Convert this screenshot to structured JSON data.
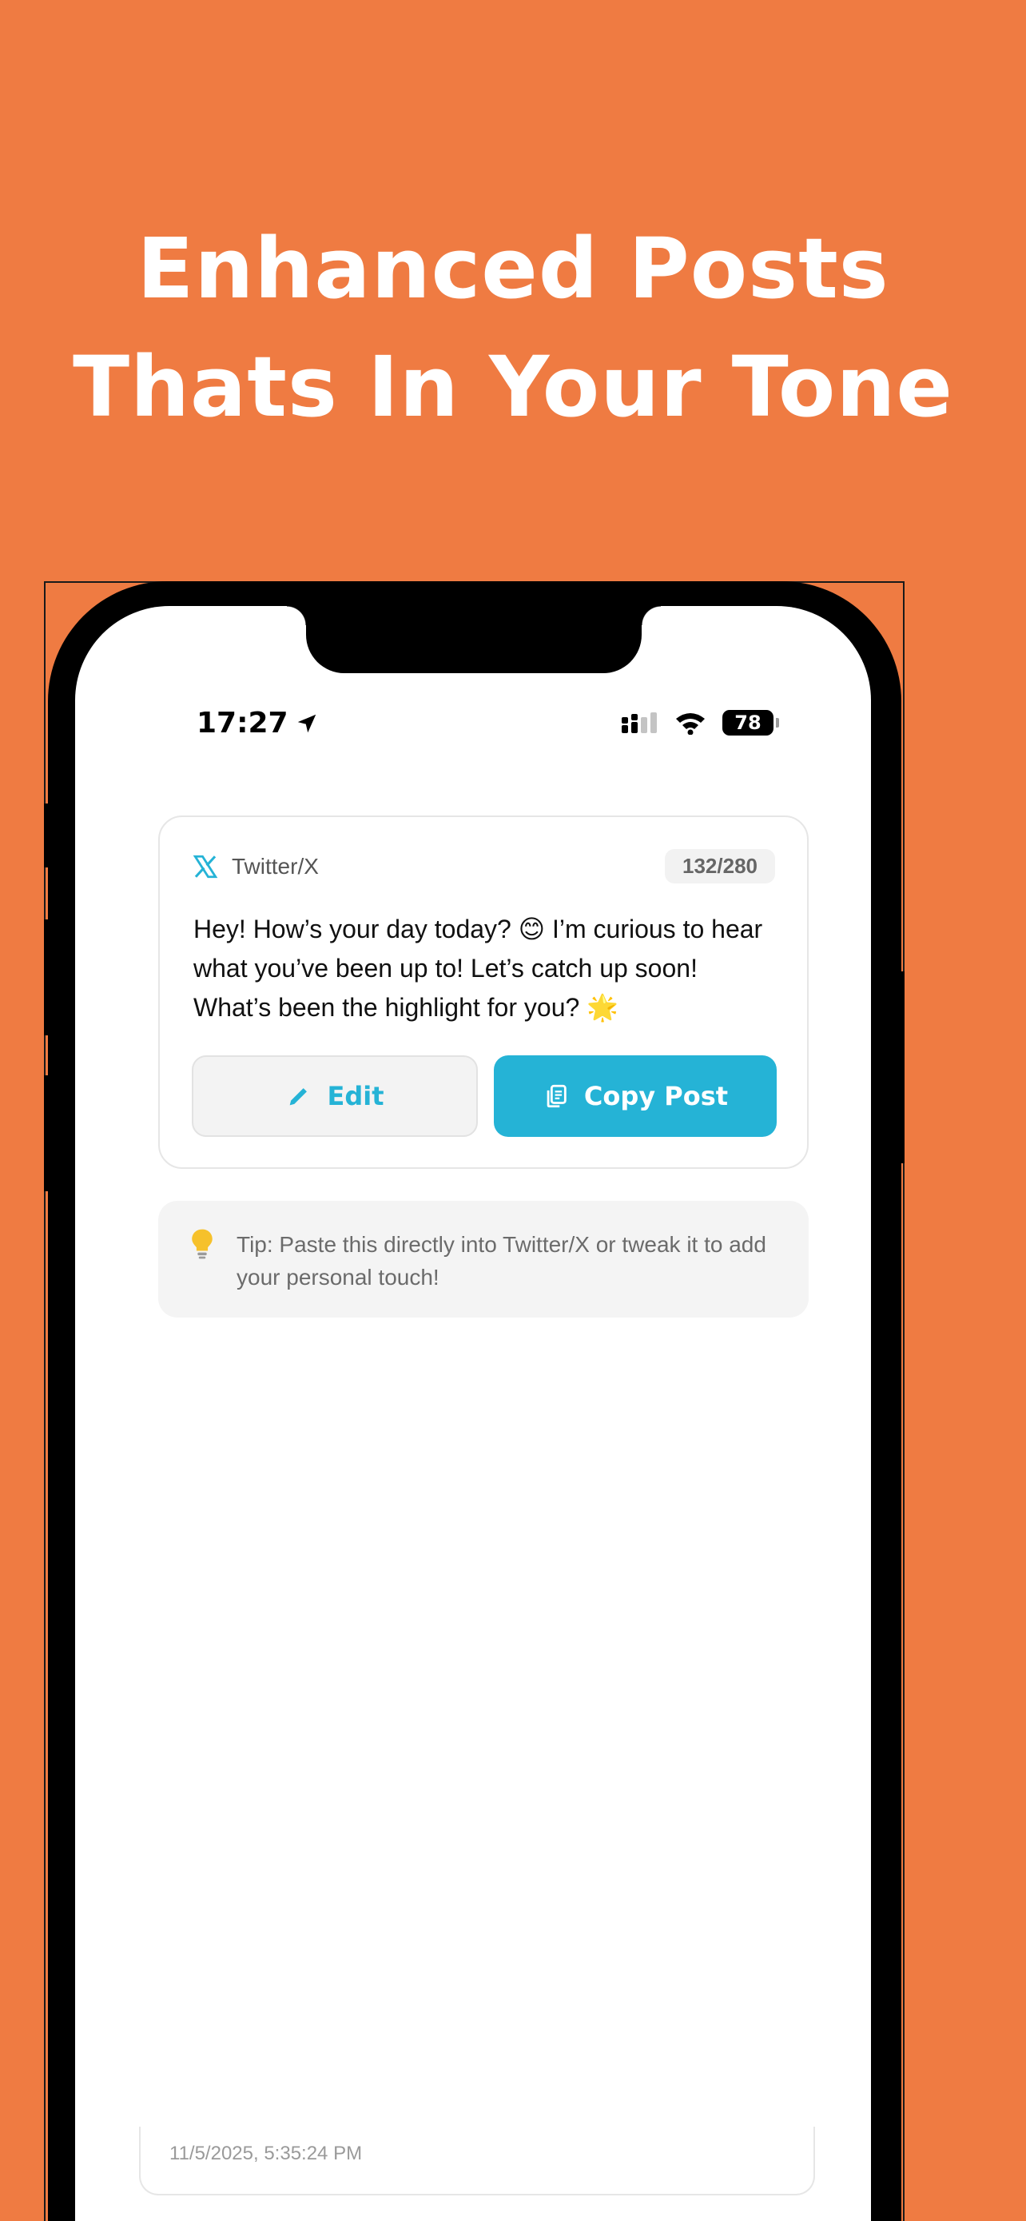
{
  "headline": {
    "line1": "Enhanced Posts",
    "line2": "Thats In Your Tone"
  },
  "status_bar": {
    "time": "17:27",
    "battery": "78",
    "icons": [
      "location-arrow-icon",
      "cellular-signal-icon",
      "wifi-icon",
      "battery-icon"
    ]
  },
  "post_card": {
    "platform_icon": "x-logo-icon",
    "platform": "Twitter/X",
    "char_count": "132/280",
    "text": "Hey! How’s your day today? 😊 I’m curious to hear what you’ve been up to! Let’s catch up soon! What’s been the highlight for you? 🌟",
    "edit_label": "Edit",
    "copy_label": "Copy Post"
  },
  "tip": {
    "icon": "lightbulb-icon",
    "text": "Tip: Paste this directly into Twitter/X or tweak it to add your personal touch!"
  },
  "history": {
    "date": "11/5/2025, 5:35:24 PM"
  },
  "colors": {
    "background": "#EF7B42",
    "accent": "#25B3D6",
    "tip_background": "#F4F4F4"
  }
}
